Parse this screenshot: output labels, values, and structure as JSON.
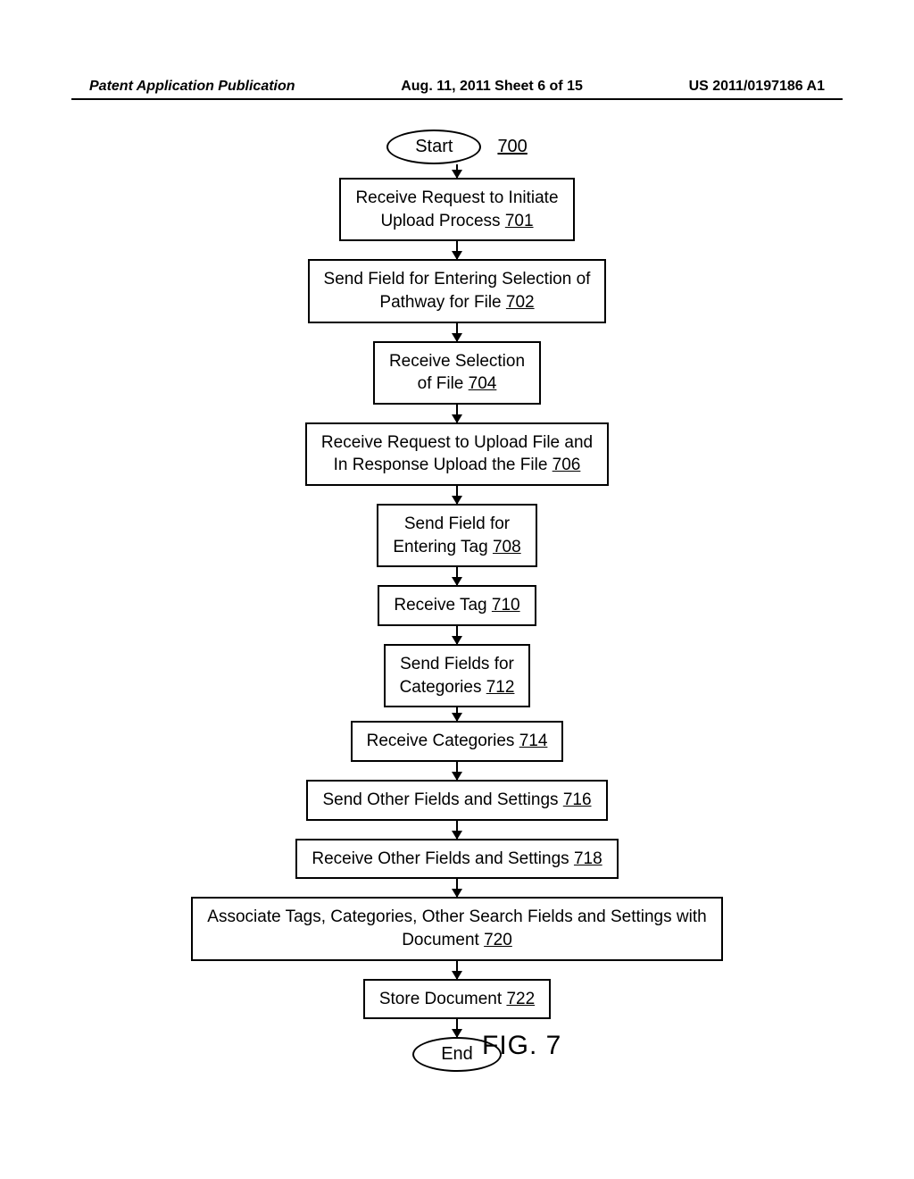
{
  "header": {
    "left": "Patent Application Publication",
    "center": "Aug. 11, 2011  Sheet 6 of 15",
    "right": "US 2011/0197186 A1"
  },
  "flowchart": {
    "start": "Start",
    "proc_ref": "700",
    "steps": [
      {
        "text": "Receive Request to Initiate\nUpload Process ",
        "ref": "701"
      },
      {
        "text": "Send Field for Entering Selection of\nPathway for File ",
        "ref": "702"
      },
      {
        "text": "Receive Selection\nof File ",
        "ref": "704"
      },
      {
        "text": "Receive Request to Upload File and\nIn Response Upload the File ",
        "ref": "706"
      },
      {
        "text": "Send Field for\nEntering Tag ",
        "ref": "708"
      },
      {
        "text": "Receive Tag ",
        "ref": "710"
      },
      {
        "text": "Send Fields for\nCategories ",
        "ref": "712"
      },
      {
        "text": "Receive Categories ",
        "ref": "714"
      },
      {
        "text": "Send Other Fields and Settings ",
        "ref": "716"
      },
      {
        "text": "Receive Other Fields and Settings ",
        "ref": "718"
      },
      {
        "text": "Associate Tags, Categories, Other Search Fields and Settings with\nDocument ",
        "ref": "720"
      },
      {
        "text": "Store Document ",
        "ref": "722"
      }
    ],
    "end": "End"
  },
  "figure_label": "FIG. 7"
}
